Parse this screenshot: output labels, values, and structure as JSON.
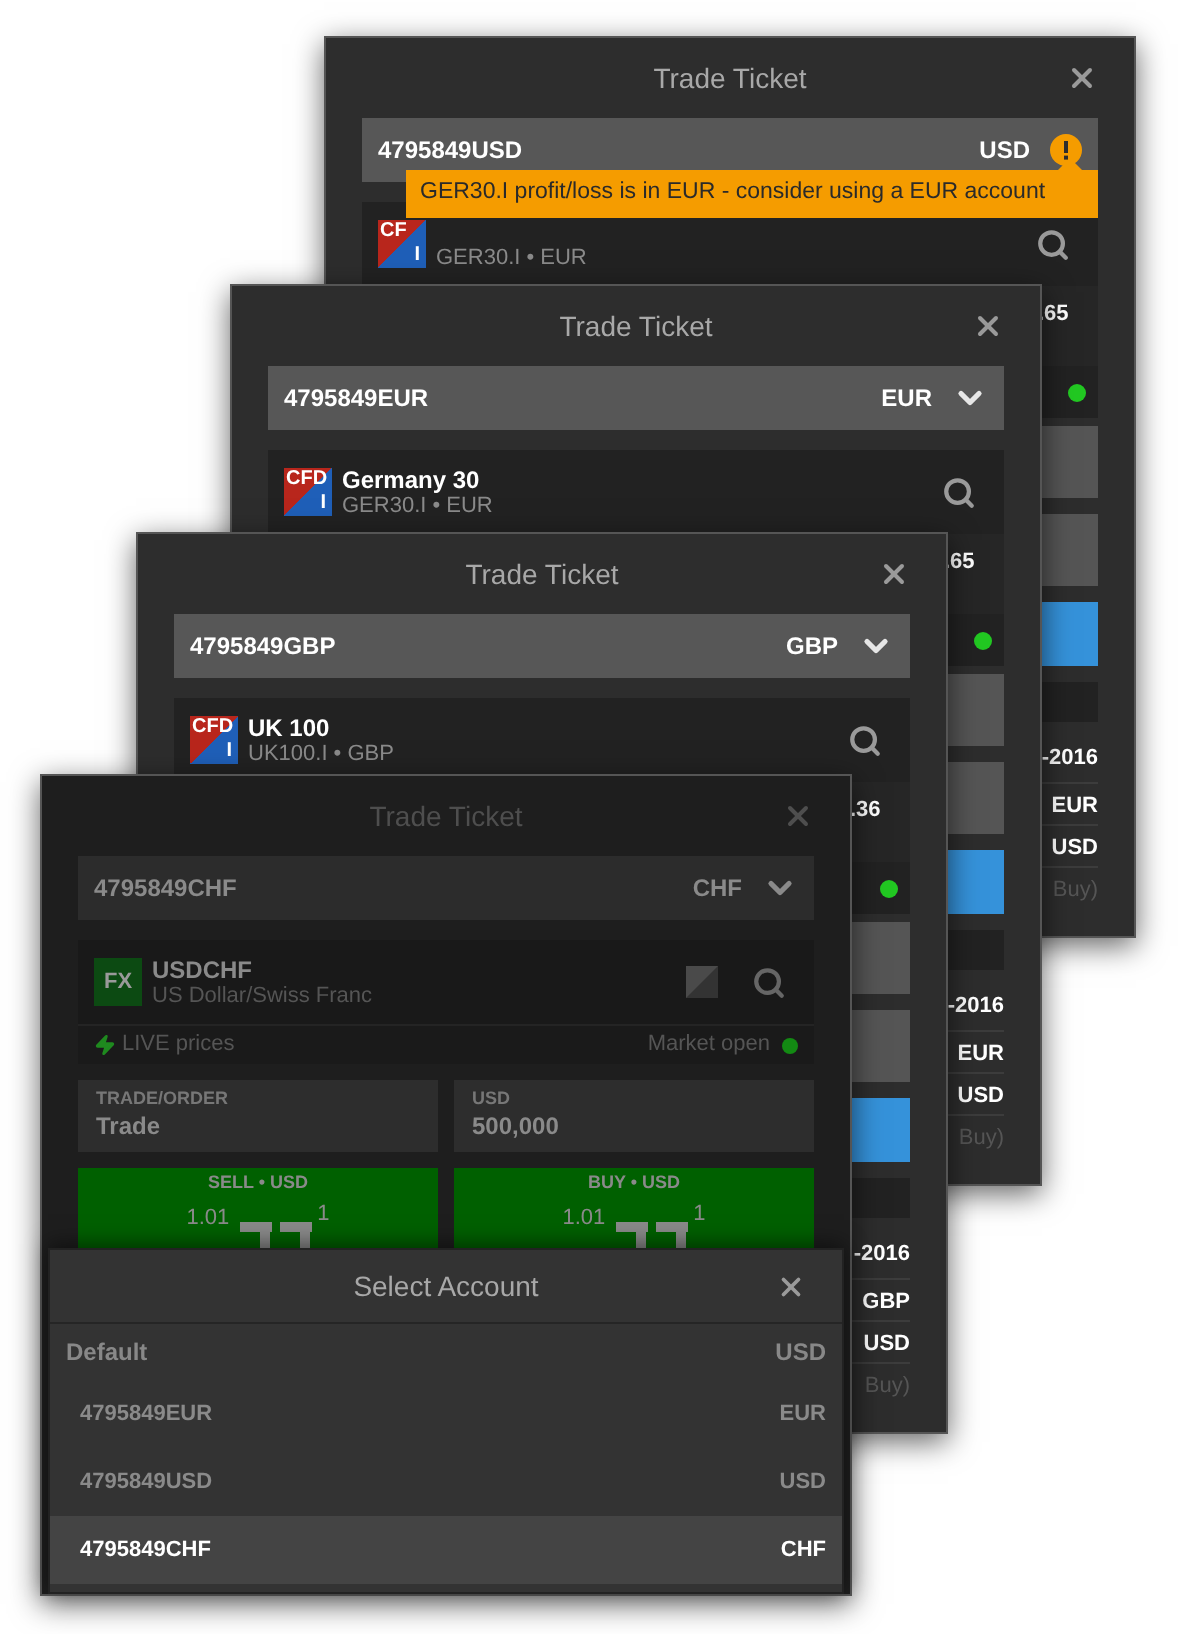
{
  "windows": [
    {
      "title": "Trade Ticket",
      "dimmed": false,
      "account": {
        "name": "4795849USD",
        "currency": "USD",
        "warning": true
      },
      "tooltip": "GER30.I profit/loss is in EUR - consider using a EUR account",
      "instrument": {
        "badge": {
          "kind": "cfd",
          "text": "CF",
          "sub": "I"
        },
        "code": "GER30.I • EUR"
      },
      "edge": {
        "price": ".65",
        "market_open": true,
        "date": "-2016",
        "currency_1": "EUR",
        "currency_2": "USD",
        "side": "Buy)"
      }
    },
    {
      "title": "Trade Ticket",
      "dimmed": false,
      "account": {
        "name": "4795849EUR",
        "currency": "EUR",
        "warning": false
      },
      "instrument": {
        "badge": {
          "kind": "cfd",
          "text": "CFD",
          "sub": "I"
        },
        "name": "Germany 30",
        "code": "GER30.I • EUR"
      },
      "edge": {
        "price": ".65",
        "market_open": true,
        "date": "-2016",
        "currency_1": "EUR",
        "currency_2": "USD",
        "side": "Buy)"
      }
    },
    {
      "title": "Trade Ticket",
      "dimmed": false,
      "account": {
        "name": "4795849GBP",
        "currency": "GBP",
        "warning": false
      },
      "instrument": {
        "badge": {
          "kind": "cfd",
          "text": "CFD",
          "sub": "I"
        },
        "name": "UK 100",
        "code": "UK100.I • GBP"
      },
      "edge": {
        "price": ".36",
        "market_open": true,
        "date": "-2016",
        "currency_1": "GBP",
        "currency_2": "USD",
        "side": "Buy)"
      }
    },
    {
      "title": "Trade Ticket",
      "dimmed": true,
      "account": {
        "name": "4795849CHF",
        "currency": "CHF",
        "warning": false
      },
      "instrument": {
        "badge": {
          "kind": "fx",
          "text": "FX"
        },
        "name": "USDCHF",
        "code": "US Dollar/Swiss Franc"
      },
      "live": {
        "label": "LIVE prices",
        "status": "Market open",
        "market_open": true
      },
      "fields": [
        {
          "label": "TRADE/ORDER",
          "value": "Trade"
        },
        {
          "label": "USD",
          "value": "500,000"
        }
      ],
      "quotes": [
        {
          "label": "SELL • USD",
          "prefix": "1.01",
          "suffix": "1"
        },
        {
          "label": "BUY • USD",
          "prefix": "1.01",
          "suffix": "1"
        }
      ],
      "dialog": {
        "title": "Select Account",
        "header": {
          "name": "Default",
          "currency": "USD"
        },
        "accounts": [
          {
            "name": "4795849EUR",
            "currency": "EUR",
            "selected": false
          },
          {
            "name": "4795849USD",
            "currency": "USD",
            "selected": false
          },
          {
            "name": "4795849CHF",
            "currency": "CHF",
            "selected": true
          }
        ]
      }
    }
  ]
}
